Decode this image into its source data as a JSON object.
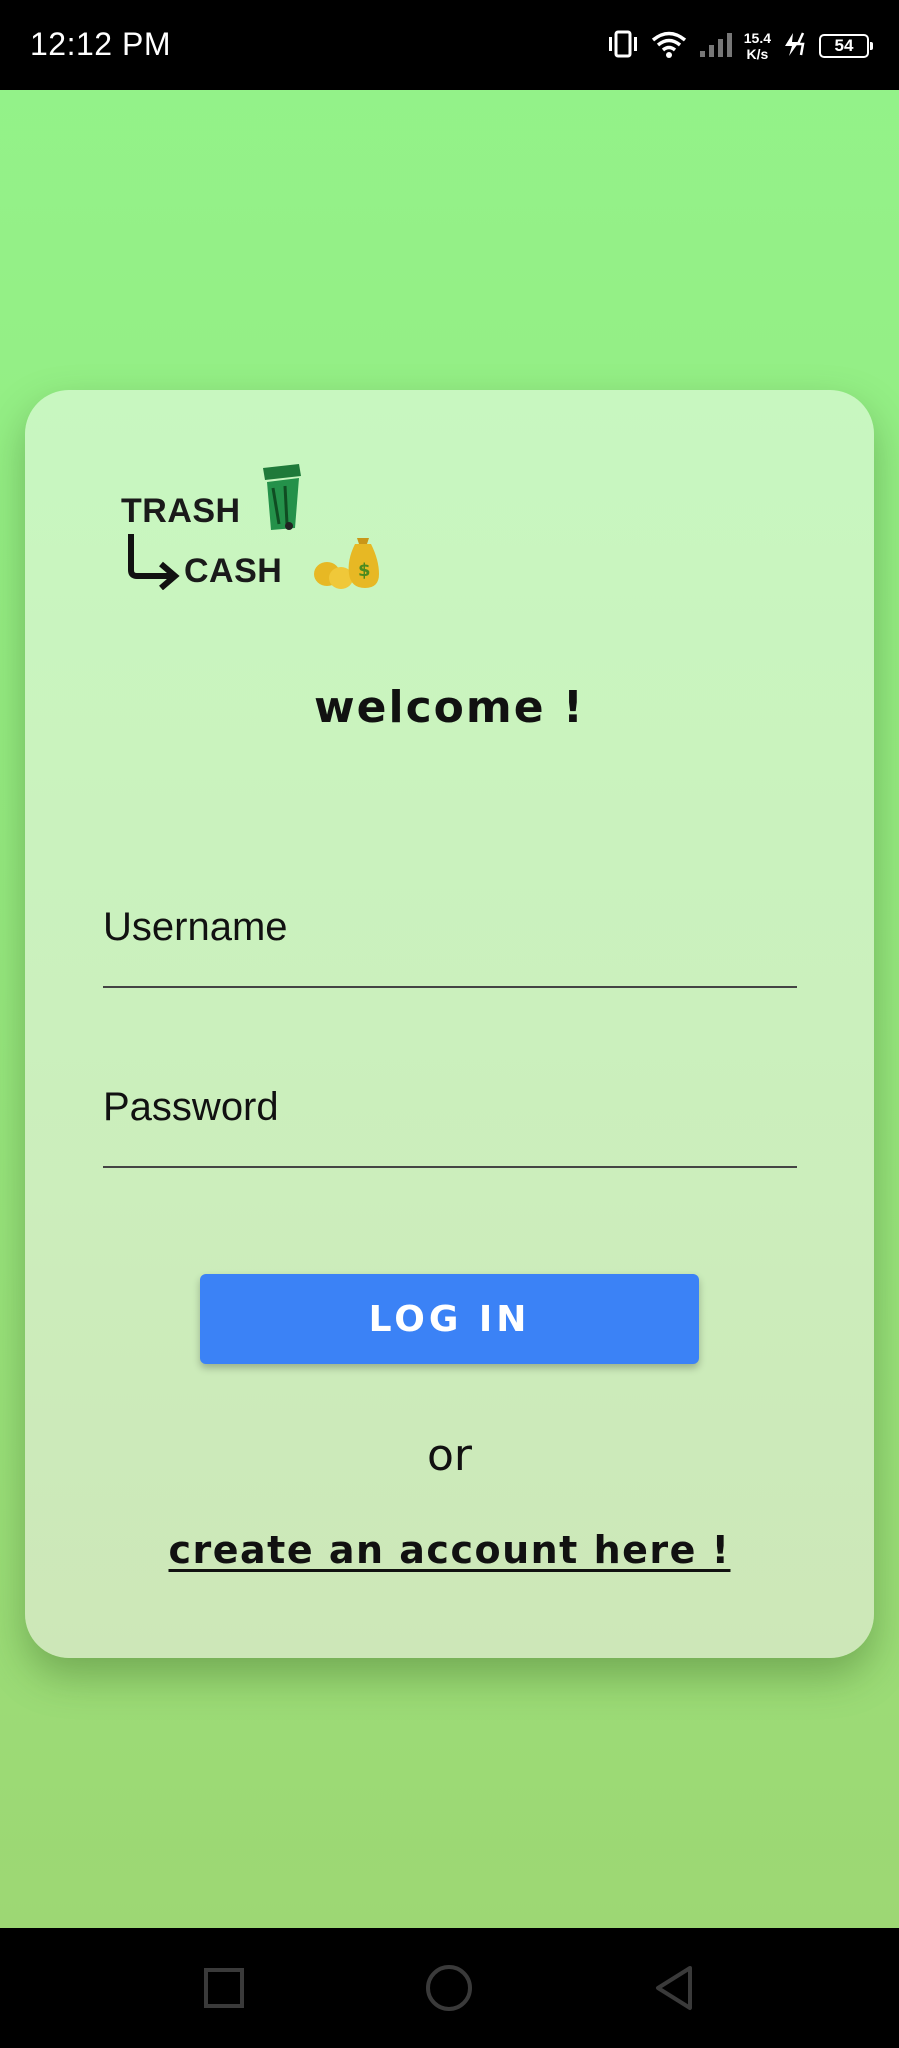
{
  "status_bar": {
    "time": "12:12 PM",
    "net_speed_value": "15.4",
    "net_speed_unit": "K/s",
    "battery_level": "54"
  },
  "logo": {
    "line1": "TRASH",
    "line2": "CASH",
    "icons": [
      "trash-bin-icon",
      "arrow-icon",
      "money-bag-icon"
    ],
    "colors": {
      "bin": "#1f7a3a",
      "money": "#e7b824"
    }
  },
  "card": {
    "title": "welcome !",
    "username_placeholder": "Username",
    "password_placeholder": "Password",
    "login_label": "LOG IN",
    "or_text": "or",
    "create_account_label": "create an account here !"
  },
  "colors": {
    "background": "#93f38a",
    "card": "#c8f7c0",
    "button": "#3b82f6"
  },
  "nav_bar": {
    "icons": [
      "recent-apps-icon",
      "home-icon",
      "back-icon"
    ]
  }
}
